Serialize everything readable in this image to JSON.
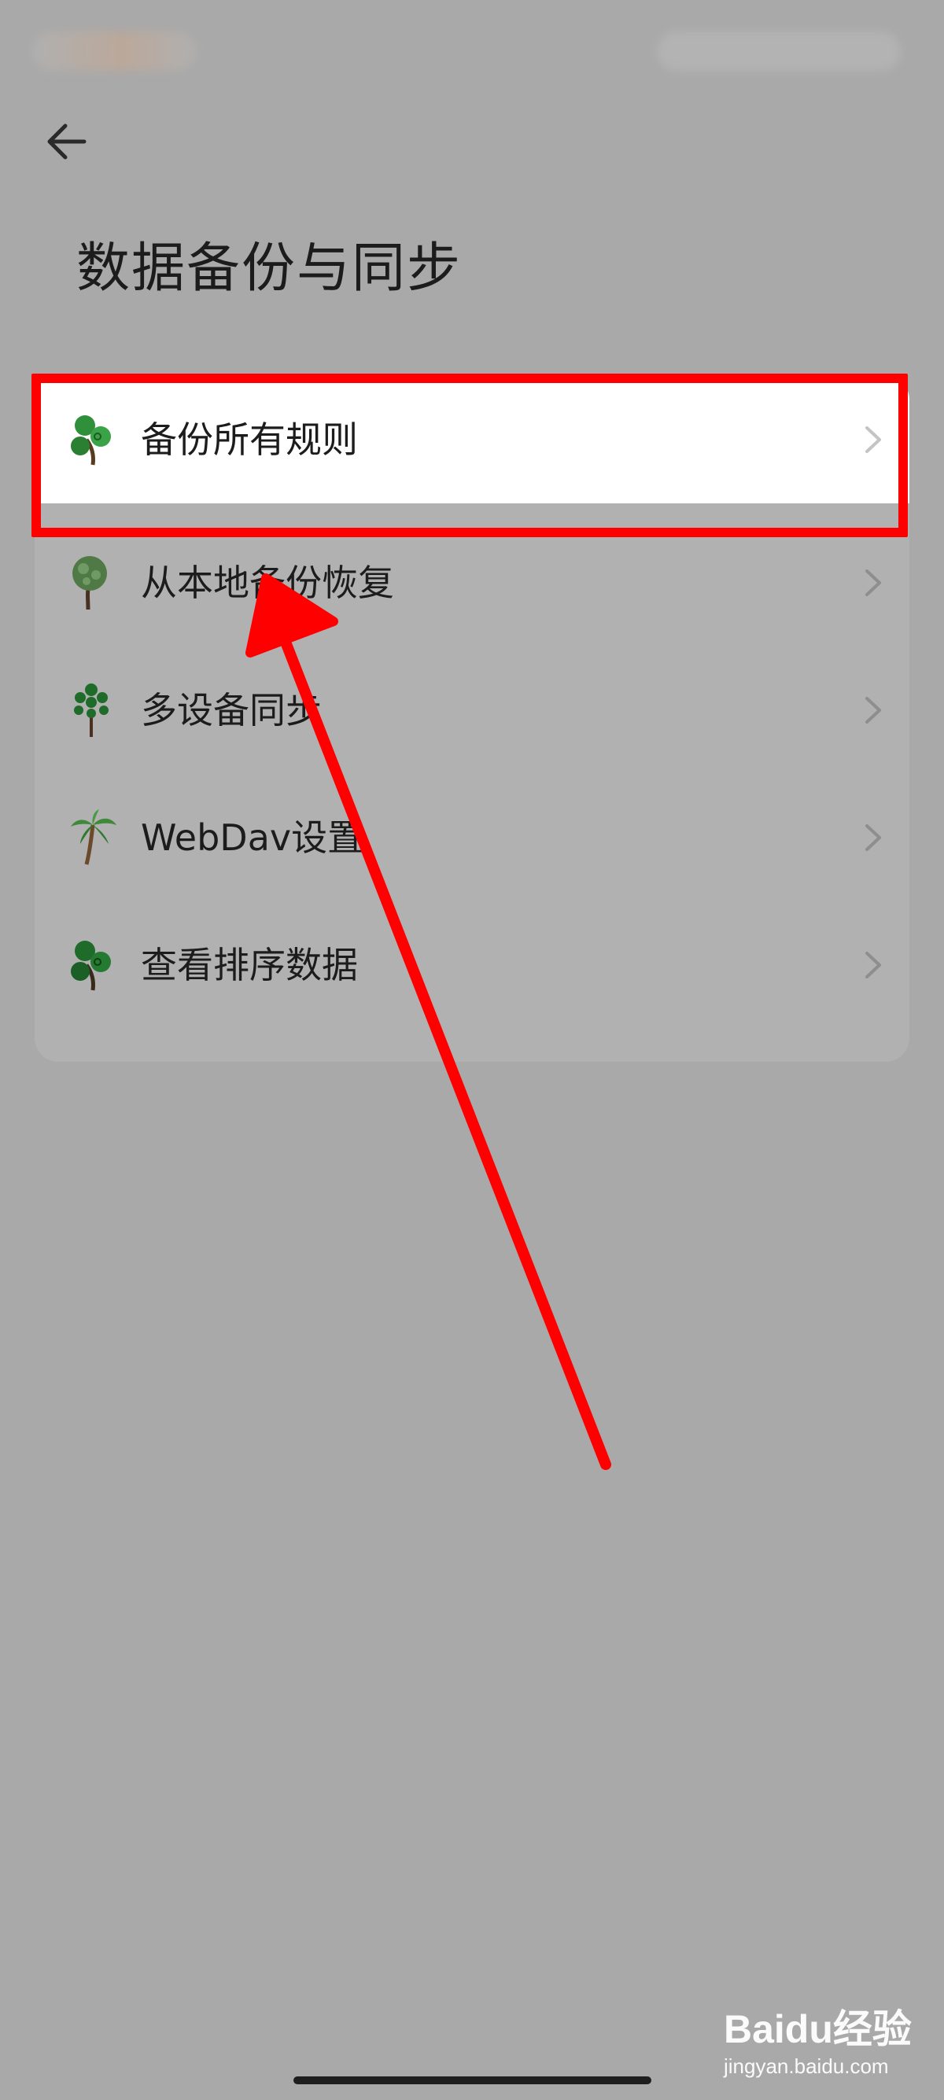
{
  "header": {
    "title": "数据备份与同步"
  },
  "menu": {
    "items": [
      {
        "label": "备份所有规则",
        "icon": "tree-icon"
      },
      {
        "label": "从本地备份恢复",
        "icon": "tree-icon"
      },
      {
        "label": "多设备同步",
        "icon": "tree-icon"
      },
      {
        "label": "WebDav设置",
        "icon": "palm-tree-icon"
      },
      {
        "label": "查看排序数据",
        "icon": "tree-icon"
      }
    ]
  },
  "annotation": {
    "highlight_color": "#ff0000"
  },
  "watermark": {
    "logo": "Baidu经验",
    "text": "jingyan.baidu.com"
  }
}
